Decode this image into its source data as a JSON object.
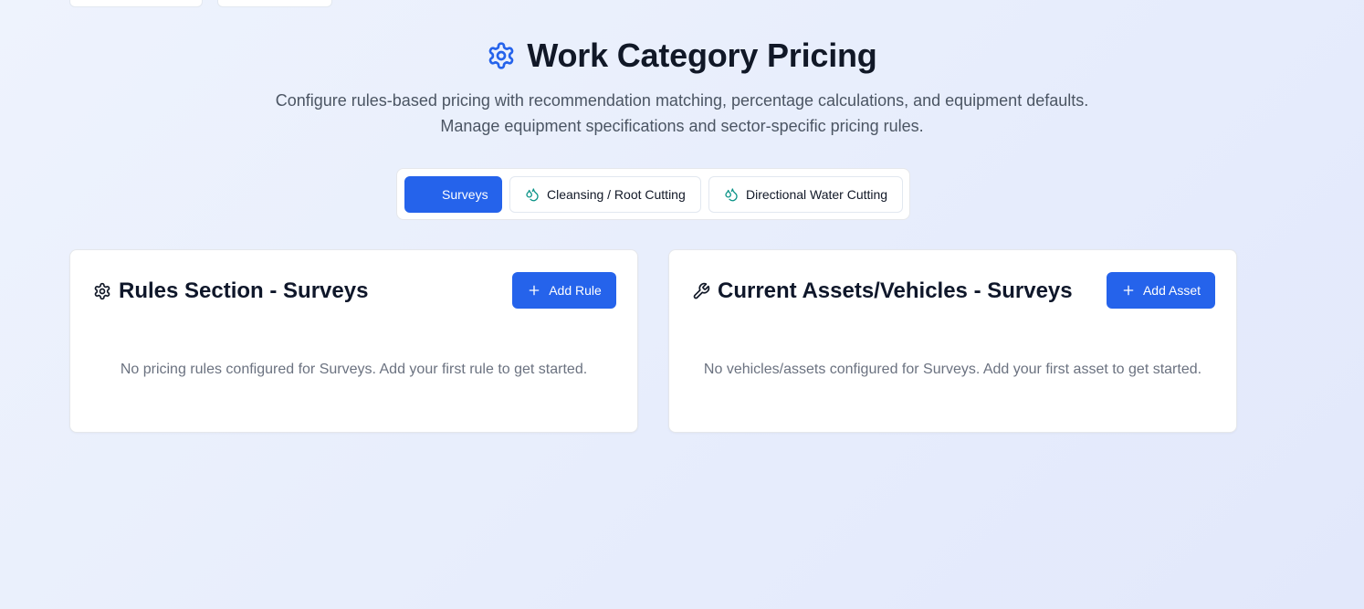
{
  "header": {
    "title": "Work Category Pricing",
    "subtitle_line1": "Configure rules-based pricing with recommendation matching, percentage calculations, and equipment defaults.",
    "subtitle_line2": "Manage equipment specifications and sector-specific pricing rules.",
    "title_icon": "gear-icon"
  },
  "tabs": [
    {
      "label": "Surveys",
      "active": true,
      "icon": ""
    },
    {
      "label": "Cleansing / Root Cutting",
      "active": false,
      "icon": "droplets-icon"
    },
    {
      "label": "Directional Water Cutting",
      "active": false,
      "icon": "droplets-icon"
    }
  ],
  "rules_card": {
    "title": "Rules Section - Surveys",
    "icon": "gear-icon",
    "button_label": "Add Rule",
    "empty_message": "No pricing rules configured for Surveys. Add your first rule to get started."
  },
  "assets_card": {
    "title": "Current Assets/Vehicles - Surveys",
    "icon": "wrench-icon",
    "button_label": "Add Asset",
    "empty_message": "No vehicles/assets configured for Surveys. Add your first asset to get started."
  },
  "colors": {
    "primary": "#2563eb",
    "accent_teal": "#0d9488",
    "title_text": "#111827",
    "muted_text": "#6b7280"
  }
}
